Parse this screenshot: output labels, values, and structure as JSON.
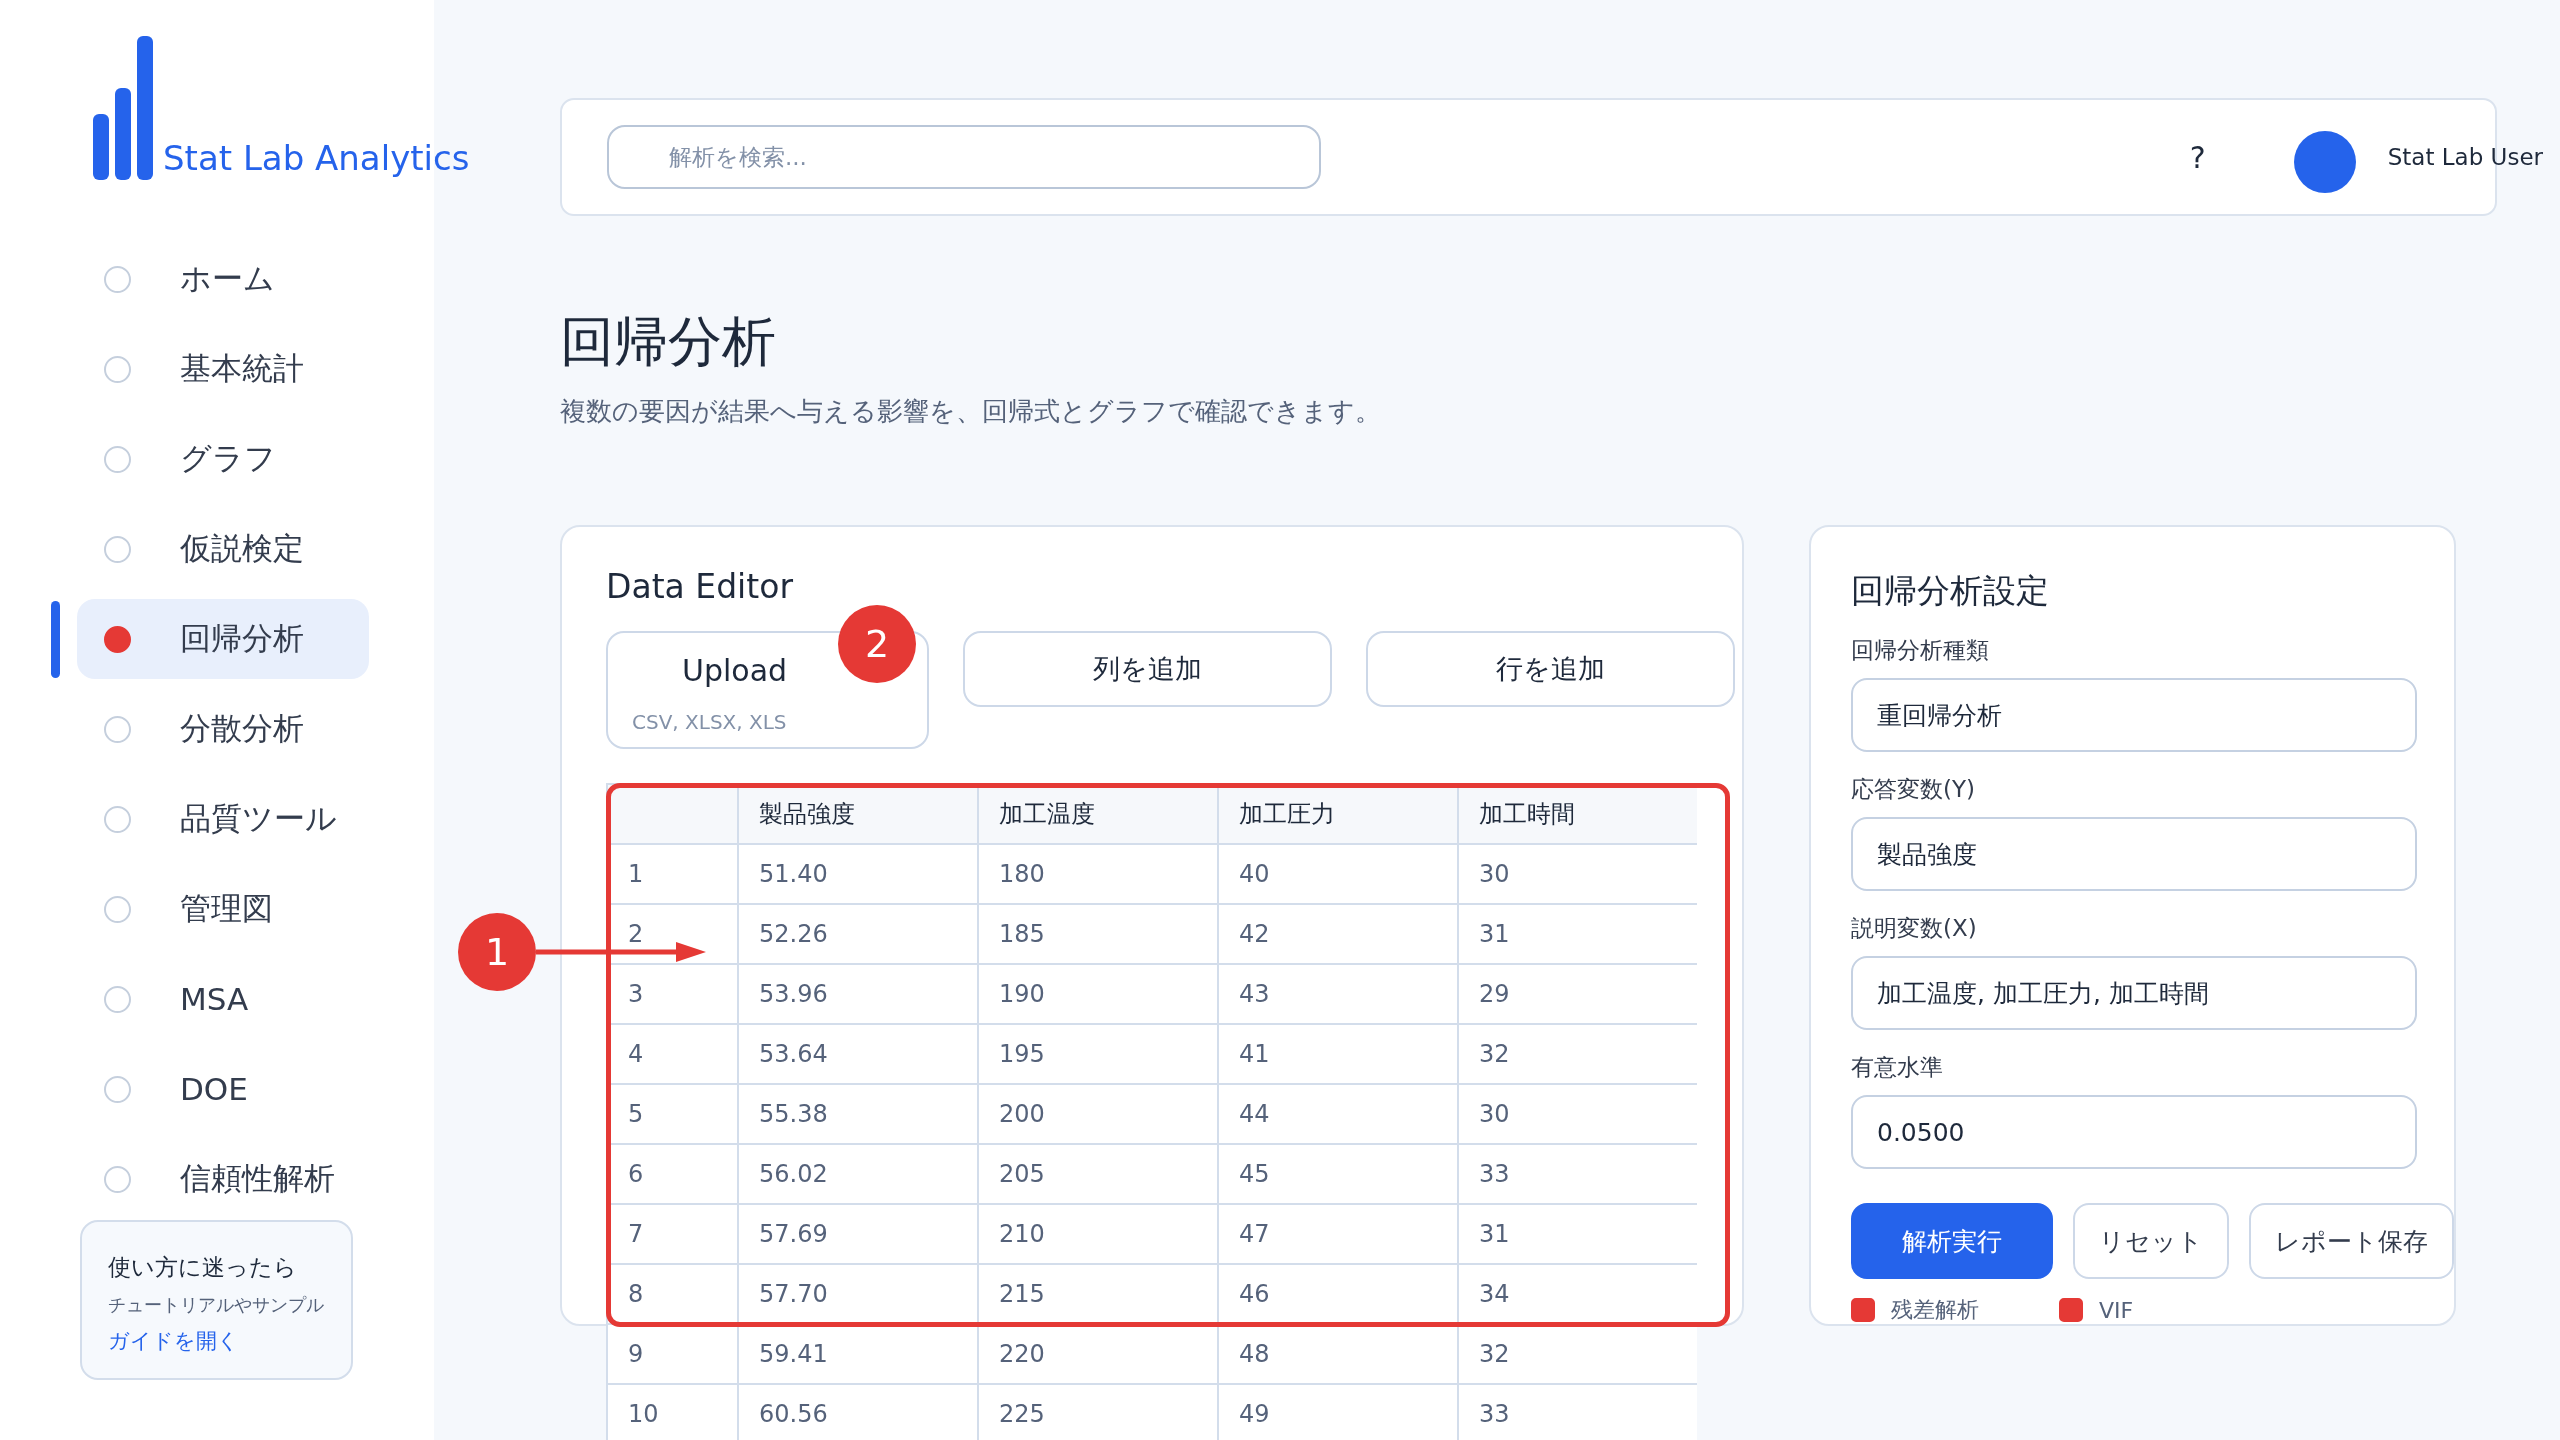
{
  "sidebar": {
    "logo": "Stat Lab Analytics",
    "items": [
      {
        "label": "ホーム",
        "selected": false
      },
      {
        "label": "基本統計",
        "selected": false
      },
      {
        "label": "グラフ",
        "selected": false
      },
      {
        "label": "仮説検定",
        "selected": false
      },
      {
        "label": "回帰分析",
        "selected": true
      },
      {
        "label": "分散分析",
        "selected": false
      },
      {
        "label": "品質ツール",
        "selected": false
      },
      {
        "label": "管理図",
        "selected": false
      },
      {
        "label": "MSA",
        "selected": false
      },
      {
        "label": "DOE",
        "selected": false
      },
      {
        "label": "信頼性解析",
        "selected": false
      }
    ],
    "help": {
      "title": "使い方に迷ったら",
      "text": "チュートリアルやサンプル",
      "link": "ガイドを開く"
    }
  },
  "header": {
    "search": {
      "placeholder": "解析を検索..."
    },
    "help": "?",
    "user": "Stat Lab User"
  },
  "page": {
    "title": "回帰分析",
    "subtitle": "複数の要因が結果へ与える影響を、回帰式とグラフで確認できます。"
  },
  "data_editor": {
    "title": "Data Editor",
    "upload": {
      "label": "Upload",
      "hint": "CSV, XLSX, XLS"
    },
    "buttons": [
      "列を追加",
      "行を追加"
    ],
    "table": {
      "columns": [
        "",
        "製品強度",
        "加工温度",
        "加工圧力",
        "加工時間"
      ],
      "rows": [
        [
          "1",
          "51.40",
          "180",
          "40",
          "30"
        ],
        [
          "2",
          "52.26",
          "185",
          "42",
          "31"
        ],
        [
          "3",
          "53.96",
          "190",
          "43",
          "29"
        ],
        [
          "4",
          "53.64",
          "195",
          "41",
          "32"
        ],
        [
          "5",
          "55.38",
          "200",
          "44",
          "30"
        ],
        [
          "6",
          "56.02",
          "205",
          "45",
          "33"
        ],
        [
          "7",
          "57.69",
          "210",
          "47",
          "31"
        ],
        [
          "8",
          "57.70",
          "215",
          "46",
          "34"
        ],
        [
          "9",
          "59.41",
          "220",
          "48",
          "32"
        ],
        [
          "10",
          "60.56",
          "225",
          "49",
          "33"
        ]
      ]
    }
  },
  "annotations": [
    {
      "label": "1"
    },
    {
      "label": "2"
    }
  ],
  "settings": {
    "title": "回帰分析設定",
    "fields": [
      {
        "label": "回帰分析種類",
        "value": "重回帰分析"
      },
      {
        "label": "応答変数(Y)",
        "value": "製品強度"
      },
      {
        "label": "説明変数(X)",
        "value": "加工温度, 加工圧力, 加工時間"
      },
      {
        "label": "有意水準",
        "value": "0.0500"
      }
    ],
    "buttons": [
      {
        "label": "解析実行",
        "kind": "primary"
      },
      {
        "label": "リセット",
        "kind": "secondary"
      },
      {
        "label": "レポート保存",
        "kind": "secondary"
      }
    ],
    "options": [
      {
        "label": "残差解析",
        "checked": true
      },
      {
        "label": "VIF",
        "checked": true
      }
    ]
  }
}
